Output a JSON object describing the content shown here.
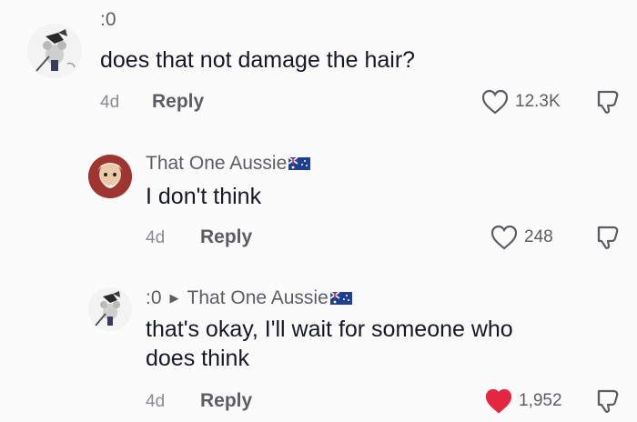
{
  "comments": [
    {
      "username": ":0",
      "text": "does that not damage the hair?",
      "age": "4d",
      "reply_label": "Reply",
      "likes": "12.3K",
      "liked": false
    },
    {
      "username": "That One Aussie",
      "text": "I don't think",
      "age": "4d",
      "reply_label": "Reply",
      "likes": "248",
      "liked": false
    },
    {
      "username": ":0",
      "reply_to": "That One Aussie",
      "text_line1": "that's okay, I'll wait for someone who",
      "text_line2": "does think",
      "age": "4d",
      "reply_label": "Reply",
      "likes": "1,952",
      "liked": true
    }
  ],
  "icons": {
    "heart": "heart-icon",
    "dislike": "dislike-icon",
    "flag": "australia-flag-icon",
    "reply_arrow": "reply-arrow-icon"
  },
  "colors": {
    "liked_heart": "#e5263f",
    "text": "#161823",
    "muted": "#8a8b91"
  }
}
